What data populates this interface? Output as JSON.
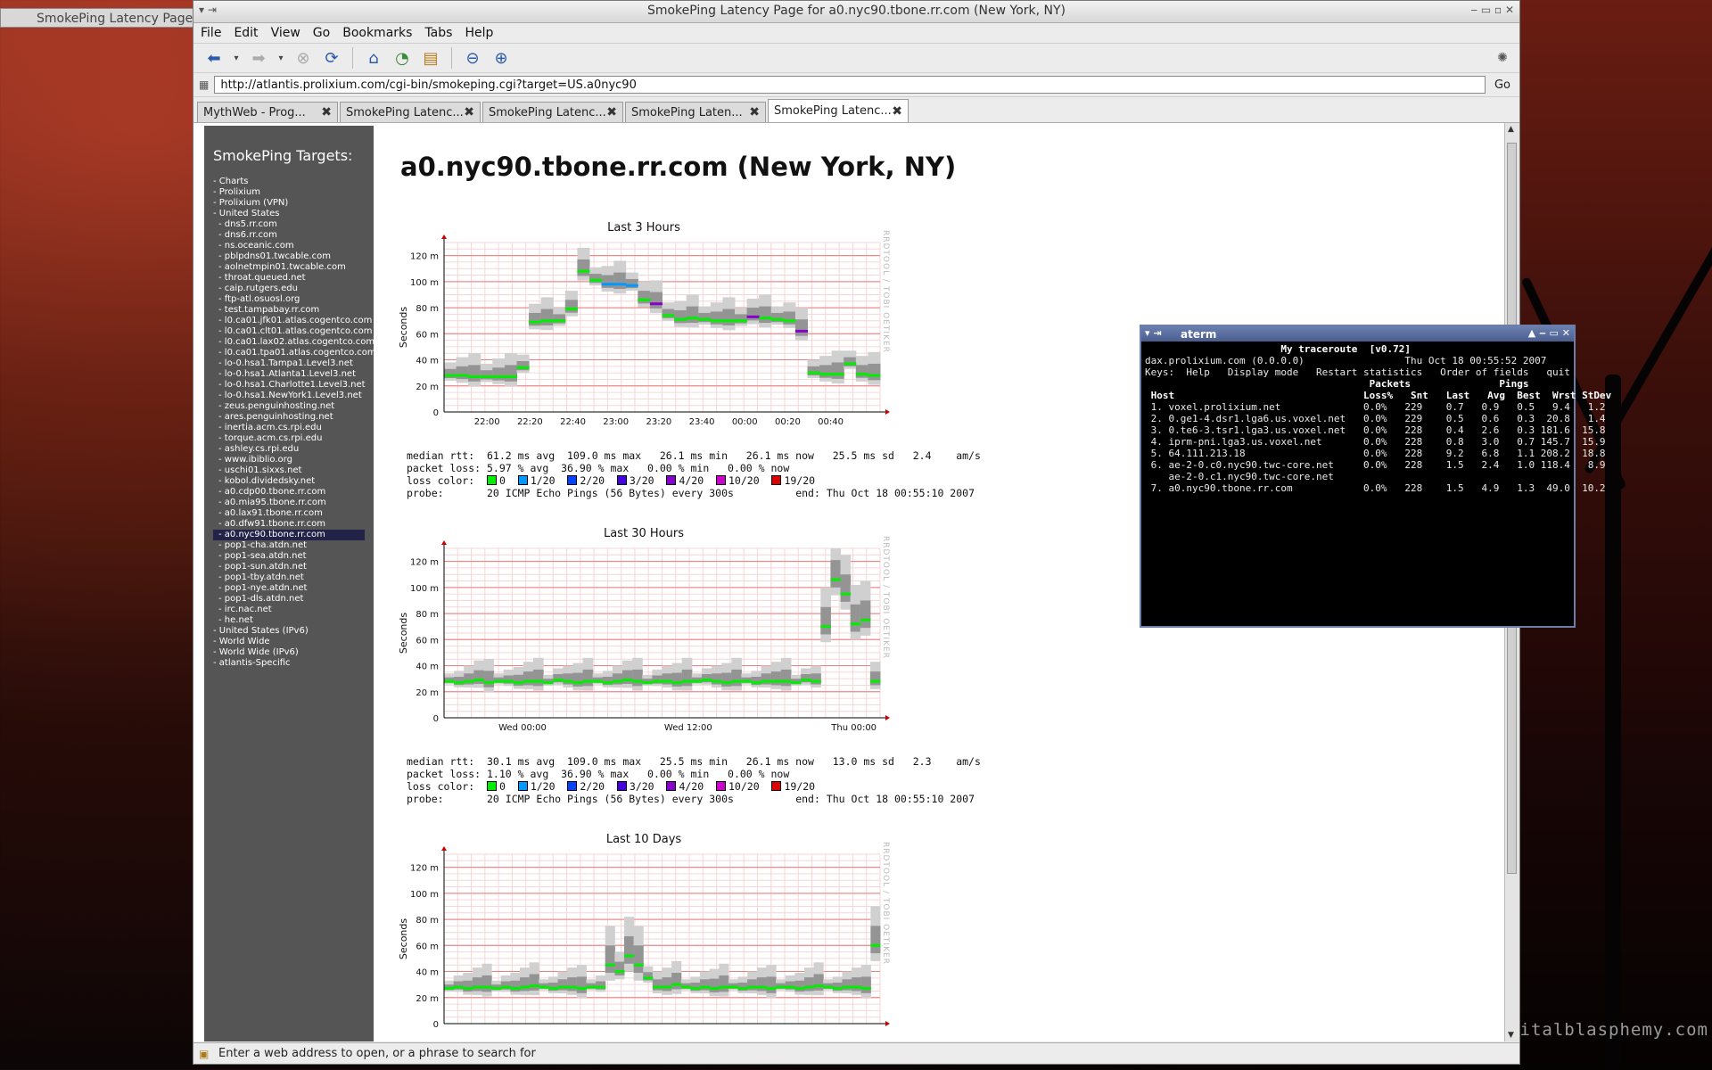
{
  "bg_tab_title": "SmokePing Latency Page",
  "watermark": "digitalblasphemy.com",
  "browser": {
    "title": "SmokePing Latency Page for a0.nyc90.tbone.rr.com (New York, NY)",
    "menu": [
      "File",
      "Edit",
      "View",
      "Go",
      "Bookmarks",
      "Tabs",
      "Help"
    ],
    "url": "http://atlantis.prolixium.com/cgi-bin/smokeping.cgi?target=US.a0nyc90",
    "go_label": "Go",
    "tabs": [
      {
        "label": "MythWeb - Prog..."
      },
      {
        "label": "SmokePing Latenc..."
      },
      {
        "label": "SmokePing Latenc..."
      },
      {
        "label": "SmokePing Laten..."
      },
      {
        "label": "SmokePing Latenc..."
      }
    ],
    "status": "Enter a web address to open, or a phrase to search for"
  },
  "sidebar": {
    "heading": "SmokePing Targets:",
    "items": [
      {
        "label": "- Charts",
        "level": 0
      },
      {
        "label": "- Prolixium",
        "level": 0
      },
      {
        "label": "- Prolixium (VPN)",
        "level": 0
      },
      {
        "label": "- United States",
        "level": 0
      },
      {
        "label": "- dns5.rr.com",
        "level": 1
      },
      {
        "label": "- dns6.rr.com",
        "level": 1
      },
      {
        "label": "- ns.oceanic.com",
        "level": 1
      },
      {
        "label": "- pblpdns01.twcable.com",
        "level": 1
      },
      {
        "label": "- aolnetmpin01.twcable.com",
        "level": 1
      },
      {
        "label": "- throat.queued.net",
        "level": 1
      },
      {
        "label": "- caip.rutgers.edu",
        "level": 1
      },
      {
        "label": "- ftp-atl.osuosl.org",
        "level": 1
      },
      {
        "label": "- test.tampabay.rr.com",
        "level": 1
      },
      {
        "label": "- l0.ca01.jfk01.atlas.cogentco.com",
        "level": 1
      },
      {
        "label": "- l0.ca01.clt01.atlas.cogentco.com",
        "level": 1
      },
      {
        "label": "- l0.ca01.lax02.atlas.cogentco.com",
        "level": 1
      },
      {
        "label": "- l0.ca01.tpa01.atlas.cogentco.com",
        "level": 1
      },
      {
        "label": "- lo-0.hsa1.Tampa1.Level3.net",
        "level": 1
      },
      {
        "label": "- lo-0.hsa1.Atlanta1.Level3.net",
        "level": 1
      },
      {
        "label": "- lo-0.hsa1.Charlotte1.Level3.net",
        "level": 1
      },
      {
        "label": "- lo-0.hsa1.NewYork1.Level3.net",
        "level": 1
      },
      {
        "label": "- zeus.penguinhosting.net",
        "level": 1
      },
      {
        "label": "- ares.penguinhosting.net",
        "level": 1
      },
      {
        "label": "- inertia.acm.cs.rpi.edu",
        "level": 1
      },
      {
        "label": "- torque.acm.cs.rpi.edu",
        "level": 1
      },
      {
        "label": "- ashley.cs.rpi.edu",
        "level": 1
      },
      {
        "label": "- www.ibiblio.org",
        "level": 1
      },
      {
        "label": "- uschi01.sixxs.net",
        "level": 1
      },
      {
        "label": "- kobol.dividedsky.net",
        "level": 1
      },
      {
        "label": "- a0.cdp00.tbone.rr.com",
        "level": 1
      },
      {
        "label": "- a0.mia95.tbone.rr.com",
        "level": 1
      },
      {
        "label": "- a0.lax91.tbone.rr.com",
        "level": 1
      },
      {
        "label": "- a0.dfw91.tbone.rr.com",
        "level": 1
      },
      {
        "label": "- a0.nyc90.tbone.rr.com",
        "level": 1,
        "selected": true
      },
      {
        "label": "- pop1-cha.atdn.net",
        "level": 1
      },
      {
        "label": "- pop1-sea.atdn.net",
        "level": 1
      },
      {
        "label": "- pop1-sun.atdn.net",
        "level": 1
      },
      {
        "label": "- pop1-tby.atdn.net",
        "level": 1
      },
      {
        "label": "- pop1-nye.atdn.net",
        "level": 1
      },
      {
        "label": "- pop1-dls.atdn.net",
        "level": 1
      },
      {
        "label": "- irc.nac.net",
        "level": 1
      },
      {
        "label": "- he.net",
        "level": 1
      },
      {
        "label": "- United States (IPv6)",
        "level": 0
      },
      {
        "label": "- World Wide",
        "level": 0
      },
      {
        "label": "- World Wide (IPv6)",
        "level": 0
      },
      {
        "label": "- atlantis-Specific",
        "level": 0
      }
    ]
  },
  "page_title": "a0.nyc90.tbone.rr.com (New York, NY)",
  "loss_legend": [
    {
      "label": "0",
      "color": "#00ee00"
    },
    {
      "label": "1/20",
      "color": "#0099ff"
    },
    {
      "label": "2/20",
      "color": "#0044ff"
    },
    {
      "label": "3/20",
      "color": "#4400dd"
    },
    {
      "label": "4/20",
      "color": "#8800cc"
    },
    {
      "label": "10/20",
      "color": "#cc00cc"
    },
    {
      "label": "19/20",
      "color": "#dd0000"
    }
  ],
  "graphs": [
    {
      "title": "Last 3 Hours",
      "ylabel": "Seconds",
      "rot_label": "RRDTOOL / TOBI OETIKER",
      "yticks": [
        "0",
        "20 m",
        "40 m",
        "60 m",
        "80 m",
        "100 m",
        "120 m"
      ],
      "xticks": [
        "22:00",
        "22:20",
        "22:40",
        "23:00",
        "23:20",
        "23:40",
        "00:00",
        "00:20",
        "00:40"
      ],
      "stat_median": "median rtt:  61.2 ms avg  109.0 ms max   26.1 ms min   26.1 ms now   25.5 ms sd   2.4    am/s",
      "stat_loss": "packet loss: 5.97 % avg  36.90 % max   0.00 % min   0.00 % now",
      "loss_label": "loss color:",
      "probe": "probe:       20 ICMP Echo Pings (56 Bytes) every 300s",
      "end": "end: Thu Oct 18 00:55:10 2007"
    },
    {
      "title": "Last 30 Hours",
      "ylabel": "Seconds",
      "rot_label": "RRDTOOL / TOBI OETIKER",
      "yticks": [
        "0",
        "20 m",
        "40 m",
        "60 m",
        "80 m",
        "100 m",
        "120 m"
      ],
      "xticks": [
        "Wed 00:00",
        "Wed 12:00",
        "Thu 00:00"
      ],
      "stat_median": "median rtt:  30.1 ms avg  109.0 ms max   25.5 ms min   26.1 ms now   13.0 ms sd   2.3    am/s",
      "stat_loss": "packet loss: 1.10 % avg  36.90 % max   0.00 % min   0.00 % now",
      "loss_label": "loss color:",
      "probe": "probe:       20 ICMP Echo Pings (56 Bytes) every 300s",
      "end": "end: Thu Oct 18 00:55:10 2007"
    },
    {
      "title": "Last 10 Days",
      "ylabel": "Seconds",
      "rot_label": "RRDTOOL / TOBI OETIKER",
      "yticks": [
        "0",
        "20 m",
        "40 m",
        "60 m",
        "80 m",
        "100 m",
        "120 m"
      ],
      "xticks": []
    }
  ],
  "chart_data": [
    {
      "type": "area",
      "title": "Last 3 Hours",
      "ylabel": "Seconds",
      "ylim": [
        0,
        130
      ],
      "x": [
        "21:55",
        "22:00",
        "22:05",
        "22:10",
        "22:15",
        "22:20",
        "22:25",
        "22:30",
        "22:35",
        "22:40",
        "22:45",
        "22:50",
        "22:55",
        "23:00",
        "23:05",
        "23:10",
        "23:15",
        "23:20",
        "23:25",
        "23:30",
        "23:35",
        "23:40",
        "23:45",
        "23:50",
        "23:55",
        "00:00",
        "00:05",
        "00:10",
        "00:15",
        "00:20",
        "00:25",
        "00:30",
        "00:35",
        "00:40",
        "00:45",
        "00:50"
      ],
      "series": [
        {
          "values": [
            28,
            28,
            27,
            27,
            27,
            27,
            34,
            69,
            70,
            70,
            79,
            108,
            101,
            98,
            98,
            97,
            86,
            83,
            74,
            71,
            72,
            71,
            70,
            70,
            70,
            73,
            72,
            71,
            70,
            62,
            30,
            29,
            29,
            37,
            29,
            28
          ]
        }
      ]
    },
    {
      "type": "area",
      "title": "Last 30 Hours",
      "ylabel": "Seconds",
      "ylim": [
        0,
        130
      ],
      "x": [
        "Wed 00:00",
        "Wed 12:00",
        "Thu 00:00"
      ],
      "series": [
        {
          "values": [
            28,
            27,
            28,
            29,
            27,
            28,
            28,
            27,
            28,
            28,
            27,
            29,
            28,
            27,
            28,
            28,
            27,
            28,
            29,
            28,
            27,
            28,
            28,
            27,
            28,
            28,
            29,
            28,
            27,
            28,
            28,
            27,
            28,
            28,
            28,
            27,
            29,
            28,
            70,
            106,
            95,
            72,
            75,
            28
          ]
        }
      ]
    },
    {
      "type": "area",
      "title": "Last 10 Days",
      "ylabel": "Seconds",
      "ylim": [
        0,
        130
      ],
      "series": [
        {
          "values": [
            27,
            28,
            27,
            28,
            28,
            27,
            28,
            27,
            28,
            29,
            28,
            27,
            28,
            28,
            27,
            28,
            28,
            45,
            40,
            52,
            45,
            35,
            28,
            28,
            30,
            28,
            27,
            28,
            27,
            28,
            28,
            27,
            28,
            28,
            27,
            28,
            28,
            27,
            28,
            29,
            28,
            27,
            28,
            28,
            27,
            60
          ]
        }
      ]
    }
  ],
  "aterm": {
    "title": "aterm",
    "lines": [
      {
        "text": "                       My traceroute  [v0.72]",
        "bold": true
      },
      {
        "text": "dax.prolixium.com (0.0.0.0)                 Thu Oct 18 00:55:52 2007"
      },
      {
        "text": "Keys:  Help   Display mode   Restart statistics   Order of fields   quit"
      },
      {
        "text": "                                      Packets               Pings",
        "bold": true
      },
      {
        "text": " Host                                Loss%   Snt   Last   Avg  Best  Wrst StDev",
        "bold": true
      },
      {
        "text": " 1. voxel.prolixium.net              0.0%   229    0.7   0.9   0.5   9.4   1.2"
      },
      {
        "text": " 2. 0.ge1-4.dsr1.lga6.us.voxel.net   0.0%   229    0.5   0.6   0.3  20.8   1.4"
      },
      {
        "text": " 3. 0.te6-3.tsr1.lga3.us.voxel.net   0.0%   228    0.4   2.6   0.3 181.6  15.8"
      },
      {
        "text": " 4. iprm-pni.lga3.us.voxel.net       0.0%   228    0.8   3.0   0.7 145.7  15.9"
      },
      {
        "text": " 5. 64.111.213.18                    0.0%   228    9.2   6.8   1.1 208.2  18.8"
      },
      {
        "text": " 6. ae-2-0.c0.nyc90.twc-core.net     0.0%   228    1.5   2.4   1.0 118.4   8.9"
      },
      {
        "text": "    ae-2-0.c1.nyc90.twc-core.net"
      },
      {
        "text": " 7. a0.nyc90.tbone.rr.com            0.0%   228    1.5   4.9   1.3  49.0  10.2"
      }
    ]
  }
}
